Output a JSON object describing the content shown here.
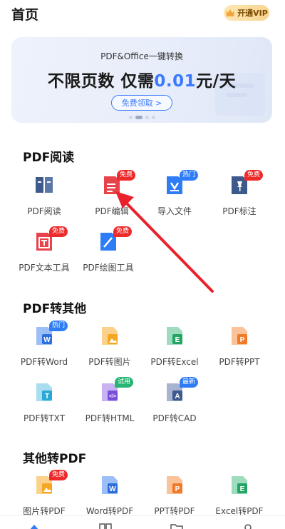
{
  "header": {
    "title": "首页",
    "vip_label": "开通VIP"
  },
  "banner": {
    "subtitle": "PDF&Office一键转换",
    "main_prefix": "不限页数 仅需",
    "main_accent": "0.01",
    "main_suffix": "元/天",
    "cta": "免费领取 >"
  },
  "sections": [
    {
      "title": "PDF阅读",
      "tools": [
        {
          "label": "PDF阅读",
          "icon": "book-icon",
          "badge": ""
        },
        {
          "label": "PDF编辑",
          "icon": "edit-doc-icon",
          "badge": "免费"
        },
        {
          "label": "导入文件",
          "icon": "import-icon",
          "badge": "热门"
        },
        {
          "label": "PDF标注",
          "icon": "pin-icon",
          "badge": "免费"
        },
        {
          "label": "PDF文本工具",
          "icon": "text-tool-icon",
          "badge": "免费"
        },
        {
          "label": "PDF绘图工具",
          "icon": "draw-tool-icon",
          "badge": "免费"
        }
      ]
    },
    {
      "title": "PDF转其他",
      "tools": [
        {
          "label": "PDF转Word",
          "icon": "word-icon",
          "badge": "热门"
        },
        {
          "label": "PDF转图片",
          "icon": "image-icon",
          "badge": ""
        },
        {
          "label": "PDF转Excel",
          "icon": "excel-icon",
          "badge": ""
        },
        {
          "label": "PDF转PPT",
          "icon": "ppt-icon",
          "badge": ""
        },
        {
          "label": "PDF转TXT",
          "icon": "txt-icon",
          "badge": ""
        },
        {
          "label": "PDF转HTML",
          "icon": "html-icon",
          "badge": "试用"
        },
        {
          "label": "PDF转CAD",
          "icon": "cad-icon",
          "badge": "最新"
        }
      ]
    },
    {
      "title": "其他转PDF",
      "tools": [
        {
          "label": "图片转PDF",
          "icon": "image-to-pdf-icon",
          "badge": "免费"
        },
        {
          "label": "Word转PDF",
          "icon": "word-to-pdf-icon",
          "badge": ""
        },
        {
          "label": "PPT转PDF",
          "icon": "ppt-to-pdf-icon",
          "badge": ""
        },
        {
          "label": "Excel转PDF",
          "icon": "excel-to-pdf-icon",
          "badge": ""
        }
      ]
    }
  ],
  "colors": {
    "accent": "#3a7afe",
    "badge_red": "#ee2b2b",
    "badge_blue": "#2f7df6",
    "badge_green": "#28b574",
    "annotation_arrow": "#e8212b"
  }
}
